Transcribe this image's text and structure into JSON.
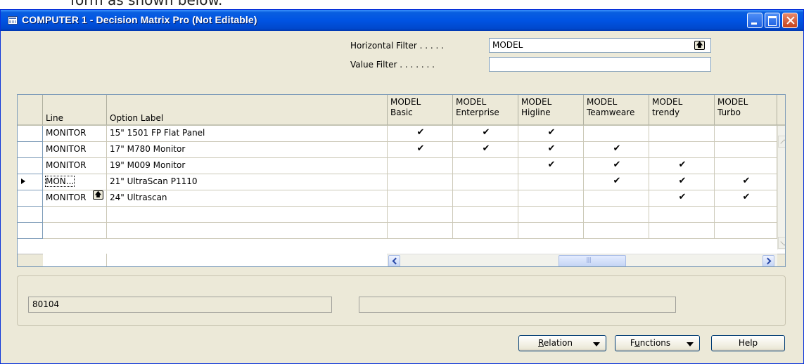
{
  "background_text": "form as shown below.",
  "window": {
    "title": "COMPUTER 1 - Decision Matrix Pro (Not Editable)"
  },
  "filters": {
    "horizontal_label": "Horizontal Filter . . . . .",
    "horizontal_value": "MODEL",
    "value_label": "Value Filter . . . . . . .",
    "value_value": ""
  },
  "grid": {
    "headers": {
      "line": "Line",
      "option_label": "Option Label"
    },
    "matrix_columns": [
      {
        "line1": "MODEL",
        "line2": "Basic"
      },
      {
        "line1": "MODEL",
        "line2": "Enterprise"
      },
      {
        "line1": "MODEL",
        "line2": "Higline"
      },
      {
        "line1": "MODEL",
        "line2": "Teamweare"
      },
      {
        "line1": "MODEL",
        "line2": "trendy"
      },
      {
        "line1": "MODEL",
        "line2": "Turbo"
      }
    ],
    "check_glyph": "✔",
    "rows": [
      {
        "line": "MONITOR",
        "label": "15\" 1501 FP Flat Panel",
        "checks": [
          true,
          true,
          true,
          false,
          false,
          false
        ]
      },
      {
        "line": "MONITOR",
        "label": "17\" M780 Monitor",
        "checks": [
          true,
          true,
          true,
          true,
          false,
          false
        ]
      },
      {
        "line": "MONITOR",
        "label": "19\" M009 Monitor",
        "checks": [
          false,
          false,
          true,
          true,
          true,
          false
        ]
      },
      {
        "line": "MON...",
        "label": "21\" UltraScan P1110",
        "checks": [
          false,
          false,
          false,
          true,
          true,
          true
        ]
      },
      {
        "line": "MONITOR",
        "label": "24\" Ultrascan",
        "checks": [
          false,
          false,
          false,
          false,
          true,
          true
        ]
      },
      {
        "line": "",
        "label": "",
        "checks": [
          false,
          false,
          false,
          false,
          false,
          false
        ]
      },
      {
        "line": "",
        "label": "",
        "checks": [
          false,
          false,
          false,
          false,
          false,
          false
        ]
      }
    ]
  },
  "status": {
    "left_value": "80104",
    "right_value": ""
  },
  "buttons": {
    "relation_underline": "R",
    "relation_rest": "elation",
    "functions_pre": "F",
    "functions_underline": "u",
    "functions_rest": "nctions",
    "help": "Help"
  }
}
